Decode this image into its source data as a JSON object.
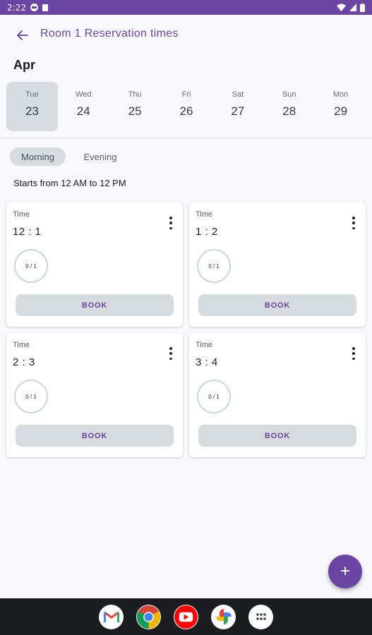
{
  "status_bar": {
    "time": "2:22"
  },
  "app_bar": {
    "title": "Room 1 Reservation times"
  },
  "month": "Apr",
  "days": [
    {
      "name": "Tue",
      "num": "23",
      "selected": true
    },
    {
      "name": "Wed",
      "num": "24"
    },
    {
      "name": "Thu",
      "num": "25"
    },
    {
      "name": "Fri",
      "num": "26"
    },
    {
      "name": "Sat",
      "num": "27"
    },
    {
      "name": "Sun",
      "num": "28"
    },
    {
      "name": "Mon",
      "num": "29"
    }
  ],
  "chips": {
    "morning": "Morning",
    "evening": "Evening"
  },
  "range_text": "Starts from 12 AM to 12 PM",
  "slots": [
    {
      "label": "Time",
      "time": "12 : 1",
      "count": "0 / 1",
      "button": "BOOK"
    },
    {
      "label": "Time",
      "time": "1 : 2",
      "count": "0 / 1",
      "button": "BOOK"
    },
    {
      "label": "Time",
      "time": "2 : 3",
      "count": "0 / 1",
      "button": "BOOK"
    },
    {
      "label": "Time",
      "time": "3 : 4",
      "count": "0 / 1",
      "button": "BOOK"
    }
  ],
  "fab": {
    "icon": "plus-icon",
    "label": "+"
  },
  "nav_apps": [
    "gmail-icon",
    "chrome-icon",
    "youtube-icon",
    "photos-icon",
    "app-drawer-icon"
  ],
  "colors": {
    "accent": "#6a45a4",
    "chip_bg": "#d5dbdf",
    "nav_bg": "#1c1d20"
  }
}
